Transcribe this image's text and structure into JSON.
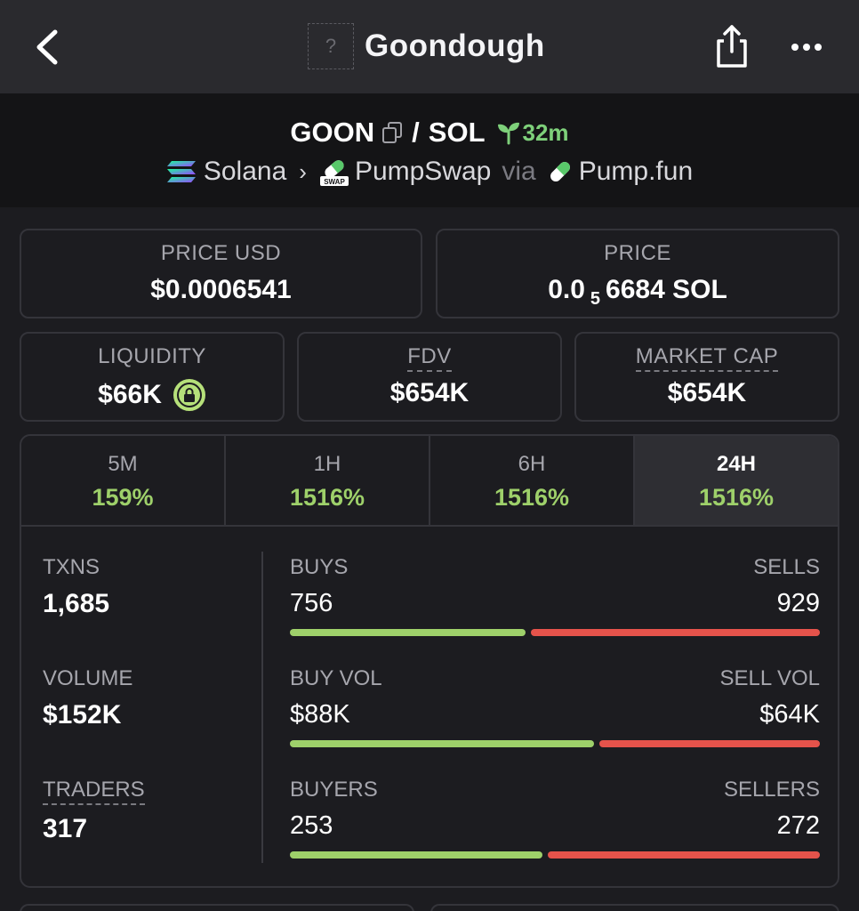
{
  "header": {
    "title": "Goondough",
    "token_icon_placeholder": "?"
  },
  "pair": {
    "base": "GOON",
    "separator": "/",
    "quote": "SOL",
    "age": "32m",
    "chain": "Solana",
    "dex": "PumpSwap",
    "via_label": "via",
    "launchpad": "Pump.fun",
    "swap_badge": "SWAP"
  },
  "prices": {
    "price_usd_label": "PRICE USD",
    "price_usd_value": "$0.0006541",
    "price_label": "PRICE",
    "price_prefix": "0.0",
    "price_zeros": "5",
    "price_suffix": "6684 SOL"
  },
  "metrics": {
    "liquidity_label": "LIQUIDITY",
    "liquidity_value": "$66K",
    "fdv_label": "FDV",
    "fdv_value": "$654K",
    "mcap_label": "MARKET CAP",
    "mcap_value": "$654K"
  },
  "tabs": [
    {
      "label": "5M",
      "value": "159%"
    },
    {
      "label": "1H",
      "value": "1516%"
    },
    {
      "label": "6H",
      "value": "1516%"
    },
    {
      "label": "24H",
      "value": "1516%"
    }
  ],
  "active_tab": "24H",
  "stats": {
    "txns_label": "TXNS",
    "txns_value": "1,685",
    "volume_label": "VOLUME",
    "volume_value": "$152K",
    "traders_label": "TRADERS",
    "traders_value": "317"
  },
  "ratios": [
    {
      "left_label": "BUYS",
      "right_label": "SELLS",
      "left_value": "756",
      "right_value": "929",
      "buy_fraction": 0.449
    },
    {
      "left_label": "BUY VOL",
      "right_label": "SELL VOL",
      "left_value": "$88K",
      "right_value": "$64K",
      "buy_fraction": 0.579
    },
    {
      "left_label": "BUYERS",
      "right_label": "SELLERS",
      "left_value": "253",
      "right_value": "272",
      "buy_fraction": 0.482
    }
  ],
  "colors": {
    "positive": "#9ed06a",
    "negative": "#e5534b",
    "age": "#7ed07a"
  },
  "icons": [
    "back-icon",
    "share-icon",
    "more-icon",
    "copy-icon",
    "sprout-icon",
    "solana-icon",
    "chevron-right-icon",
    "pumpswap-icon",
    "pill-icon",
    "lock-icon"
  ]
}
